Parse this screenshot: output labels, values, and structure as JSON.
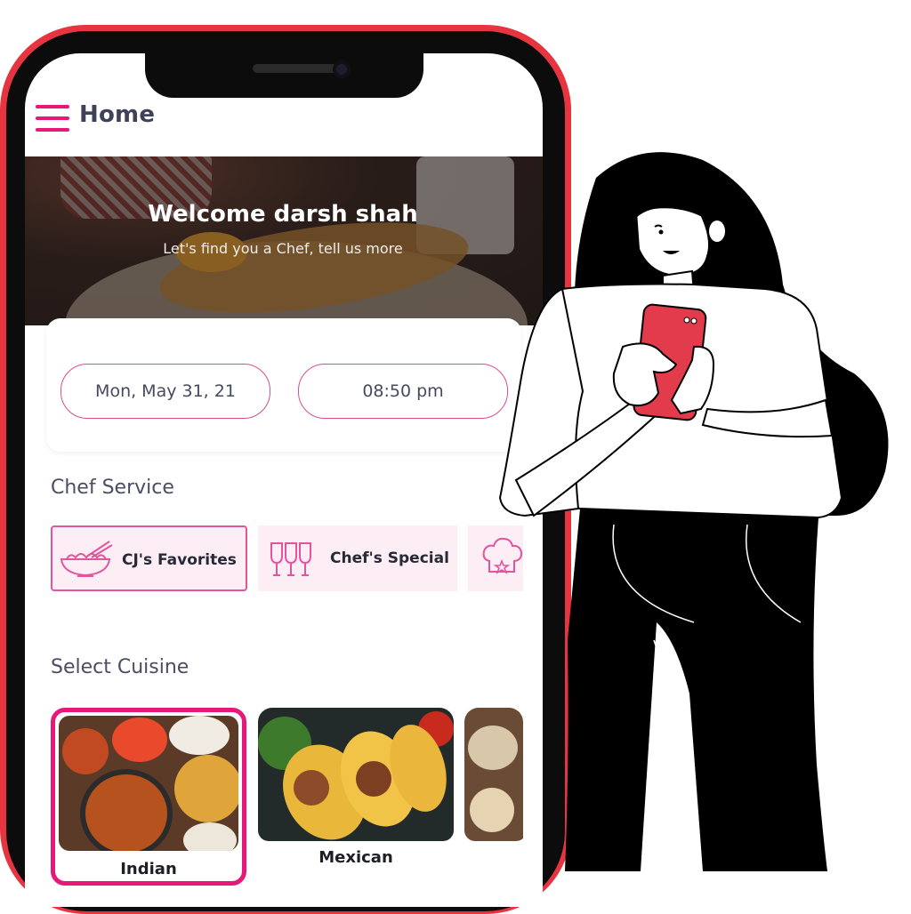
{
  "header": {
    "title": "Home",
    "menu_icon": "hamburger-menu-icon"
  },
  "hero": {
    "welcome": "Welcome darsh shah",
    "subtitle": "Let's find you a Chef, tell us more"
  },
  "schedule": {
    "date": "Mon, May 31, 21",
    "time": "08:50 pm"
  },
  "chef_service": {
    "title": "Chef Service",
    "items": [
      {
        "label": "CJ's Favorites",
        "icon": "noodle-bowl-icon",
        "selected": true
      },
      {
        "label": "Chef's Special",
        "icon": "wine-glasses-icon",
        "selected": false
      },
      {
        "label": "",
        "icon": "chef-hat-icon",
        "selected": false
      }
    ]
  },
  "cuisine": {
    "title": "Select Cuisine",
    "items": [
      {
        "label": "Indian",
        "selected": true
      },
      {
        "label": "Mexican",
        "selected": false
      },
      {
        "label": "",
        "selected": false
      }
    ]
  },
  "colors": {
    "accent": "#e8177a",
    "phone_frame": "#e63540",
    "chip_bg": "#fdeef6",
    "phone_in_hand": "#e23b4b"
  }
}
